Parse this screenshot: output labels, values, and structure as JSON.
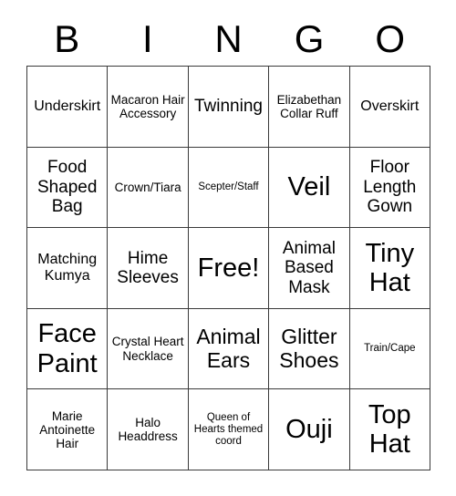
{
  "card": {
    "header_letters": [
      "B",
      "I",
      "N",
      "G",
      "O"
    ],
    "grid": {
      "rows": 5,
      "columns": 5,
      "line_color": "#3a3a3a",
      "background_color": "#ffffff",
      "text_color": "#000000"
    },
    "cells": [
      {
        "text": "Underskirt",
        "size": "m"
      },
      {
        "text": "Macaron Hair Accessory",
        "size": "s"
      },
      {
        "text": "Twinning",
        "size": "l"
      },
      {
        "text": "Elizabethan Collar Ruff",
        "size": "s"
      },
      {
        "text": "Overskirt",
        "size": "m"
      },
      {
        "text": "Food Shaped Bag",
        "size": "l"
      },
      {
        "text": "Crown/Tiara",
        "size": "s"
      },
      {
        "text": "Scepter/Staff",
        "size": "xs"
      },
      {
        "text": "Veil",
        "size": "xxl"
      },
      {
        "text": "Floor Length Gown",
        "size": "l"
      },
      {
        "text": "Matching Kumya",
        "size": "m"
      },
      {
        "text": "Hime Sleeves",
        "size": "l"
      },
      {
        "text": "Free!",
        "size": "xxl"
      },
      {
        "text": "Animal Based Mask",
        "size": "l"
      },
      {
        "text": "Tiny Hat",
        "size": "xxl"
      },
      {
        "text": "Face Paint",
        "size": "xxl"
      },
      {
        "text": "Crystal Heart Necklace",
        "size": "s"
      },
      {
        "text": "Animal Ears",
        "size": "xl"
      },
      {
        "text": "Glitter Shoes",
        "size": "xl"
      },
      {
        "text": "Train/Cape",
        "size": "xs"
      },
      {
        "text": "Marie Antoinette Hair",
        "size": "s"
      },
      {
        "text": "Halo Headdress",
        "size": "s"
      },
      {
        "text": "Queen of Hearts themed coord",
        "size": "xs"
      },
      {
        "text": "Ouji",
        "size": "xxl"
      },
      {
        "text": "Top Hat",
        "size": "xxl"
      }
    ]
  }
}
